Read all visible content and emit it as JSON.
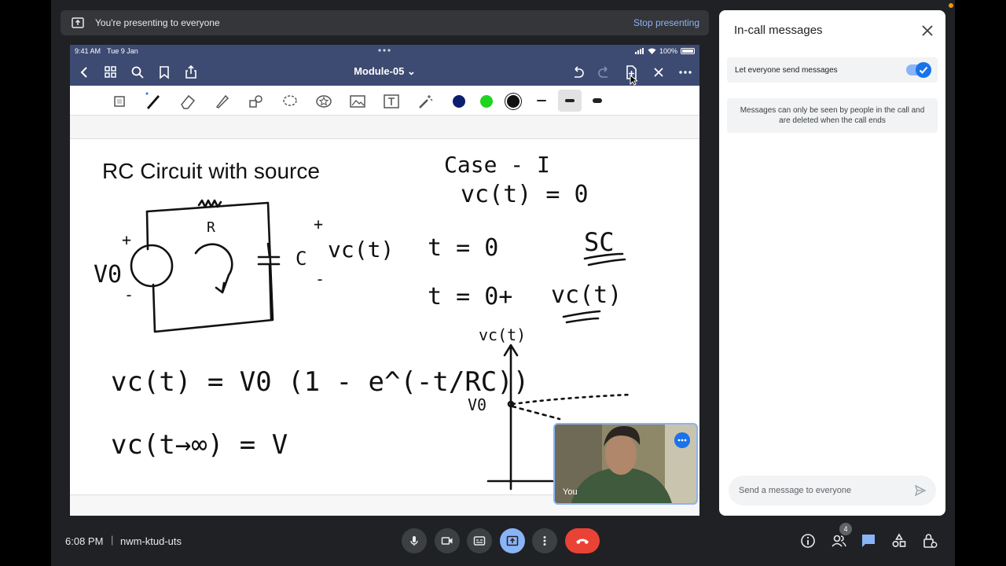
{
  "banner": {
    "text": "You're presenting to everyone",
    "stop_label": "Stop presenting"
  },
  "ipad": {
    "time": "9:41 AM",
    "date": "Tue 9 Jan",
    "battery": "100%",
    "doc_title": "Module-05 ⌄",
    "colors": [
      "#0b1f6e",
      "#1ed41e",
      "#111111"
    ]
  },
  "note": {
    "title": "RC Circuit with source",
    "handwriting": [
      "Case - I",
      "vc(t) = 0",
      "t = 0",
      "t = 0+",
      "SC",
      "vc(t)",
      "vc(t) = V0 (1 - e^(-t/RC))",
      "vc(t→∞) = V",
      "R",
      "C",
      "V0",
      "+",
      "-"
    ]
  },
  "self_view": {
    "label": "You"
  },
  "panel": {
    "title": "In-call messages",
    "toggle_label": "Let everyone send messages",
    "toggle_on": true,
    "info": "Messages can only be seen by people in the call and are deleted when the call ends",
    "input_placeholder": "Send a message to everyone"
  },
  "meeting": {
    "time": "6:08 PM",
    "separator": "|",
    "code": "nwm-ktud-uts",
    "people_count": "4"
  },
  "icons": [
    "present-icon",
    "mic-icon",
    "camera-icon",
    "captions-icon",
    "present-screen-icon",
    "more-icon",
    "end-call-icon",
    "info-icon",
    "people-icon",
    "chat-icon",
    "activities-icon",
    "host-controls-icon",
    "close-icon",
    "send-icon"
  ]
}
